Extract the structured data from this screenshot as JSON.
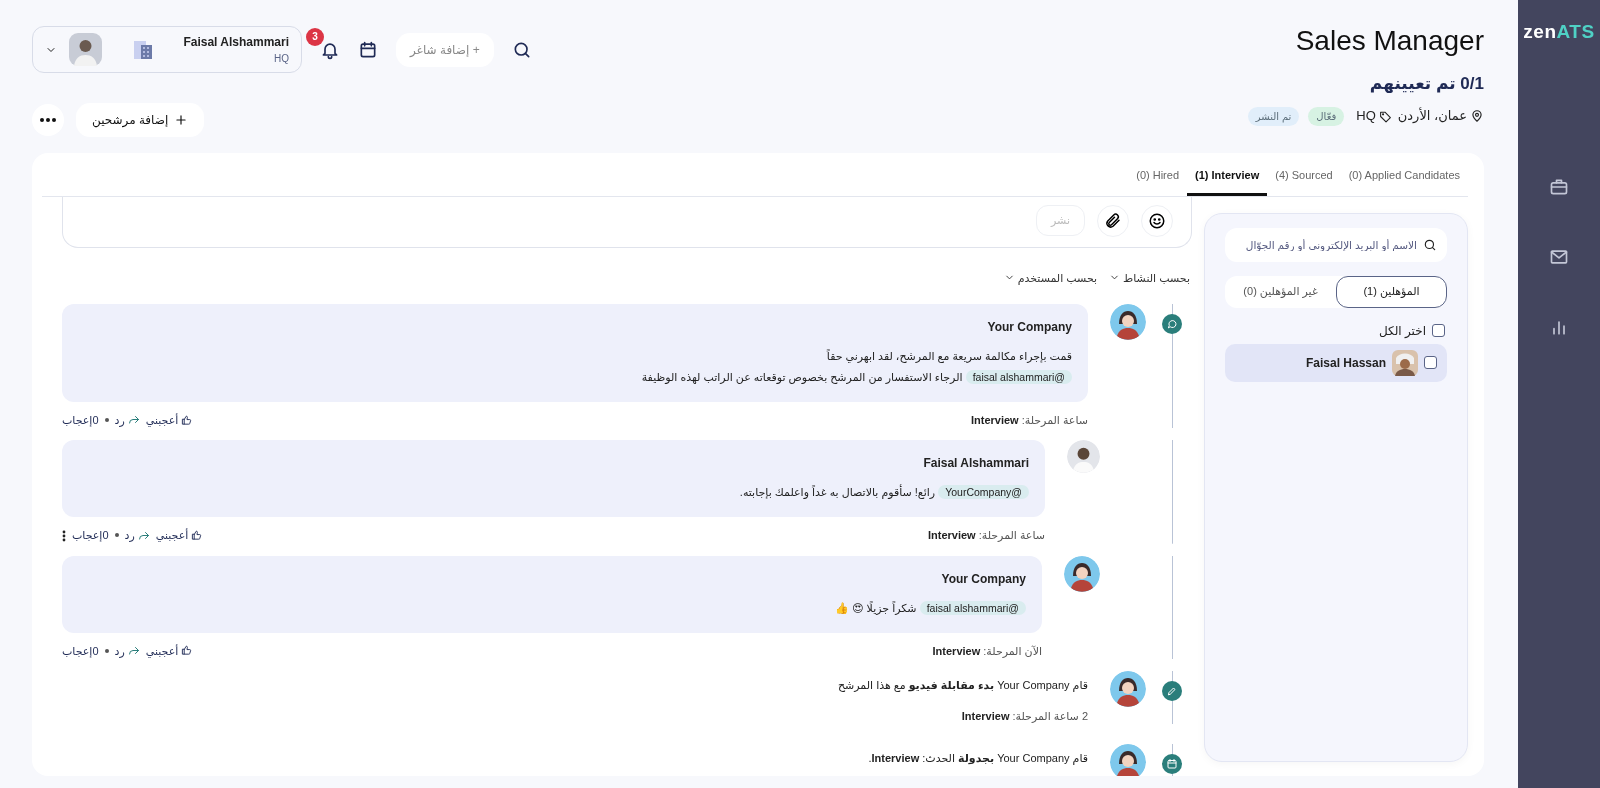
{
  "sidebar": {
    "logo_main": "zen",
    "logo_accent": "ATS"
  },
  "header": {
    "title": "Sales Manager",
    "hired": "0/1 تم تعيينهم",
    "location": "عمان، الأردن",
    "tag": "HQ",
    "badges": [
      {
        "label": "فعّال",
        "color": "#d7f2e3"
      },
      {
        "label": "تم النشر",
        "color": "#e1eefa"
      }
    ]
  },
  "toolbar": {
    "add_job": "+ إضافة شاغر",
    "notifications": "3",
    "profile": {
      "name": "Faisal Alshammari",
      "subtitle": "HQ"
    },
    "add_candidates": "إضافة مرشحين"
  },
  "tabs": [
    {
      "label": "(0) Applied Candidates",
      "selected": false
    },
    {
      "label": "(4) Sourced",
      "selected": false
    },
    {
      "label": "(1) Interview",
      "selected": true
    },
    {
      "label": "(0) Hired",
      "selected": false
    }
  ],
  "candidates_panel": {
    "search": {
      "placeholder": "الاسم أو البريد الإلكتروني أو رقم الجوّال"
    },
    "filters": [
      {
        "label": "المؤهلين (1)",
        "selected": true
      },
      {
        "label": "غير المؤهلين (0)",
        "selected": false
      }
    ],
    "select_all": {
      "label": "اختر الكل",
      "checked": false
    },
    "candidates": [
      {
        "name": "Faisal Hassan",
        "checked": false,
        "selected": true
      }
    ]
  },
  "composer": {
    "post": "نشر",
    "disabled": true
  },
  "feed_filters": [
    "بحسب النشاط",
    "بحسب المستخدم"
  ],
  "feed": [
    {
      "kind": "comment",
      "author": "Your Company",
      "lines": [
        {
          "text": "قمت بإجراء مكالمة سريعة مع المرشح، لقد ابهرني حقاً"
        },
        {
          "mention": "@faisal alshammari",
          "text": "الرجاء الاستفسار من المرشح بخصوص توقعاته عن الراتب لهذه الوظيفة"
        }
      ],
      "stage": "ساعة المرحلة: **Interview**",
      "like": "أعجبني",
      "reply": "رد",
      "likes": "0إعجاب",
      "more_menu": false
    },
    {
      "kind": "reply",
      "author": "Faisal Alshammari",
      "lines": [
        {
          "mention": "@YourCompany",
          "text": "رائع! سأقوم بالاتصال به غداً واعلمك بإجابته."
        }
      ],
      "stage": "ساعة المرحلة: **Interview**",
      "like": "أعجبني",
      "reply": "رد",
      "likes": "0إعجاب",
      "more_menu": true
    },
    {
      "kind": "reply",
      "author": "Your Company",
      "lines": [
        {
          "mention": "@faisal alshammari",
          "text": "شكراً جزيلًا 😍 👍"
        }
      ],
      "stage": "الآن المرحلة: **Interview**",
      "like": "أعجبني",
      "reply": "رد",
      "likes": "0إعجاب",
      "more_menu": false
    },
    {
      "kind": "video",
      "text": "قام Your Company **بدء مقابلة فيديو** مع هذا المرشح",
      "stage": "2 ساعة المرحلة: **Interview**"
    },
    {
      "kind": "schedule",
      "text": "قام Your Company **بجدولة** الحدث: **Interview**."
    }
  ]
}
